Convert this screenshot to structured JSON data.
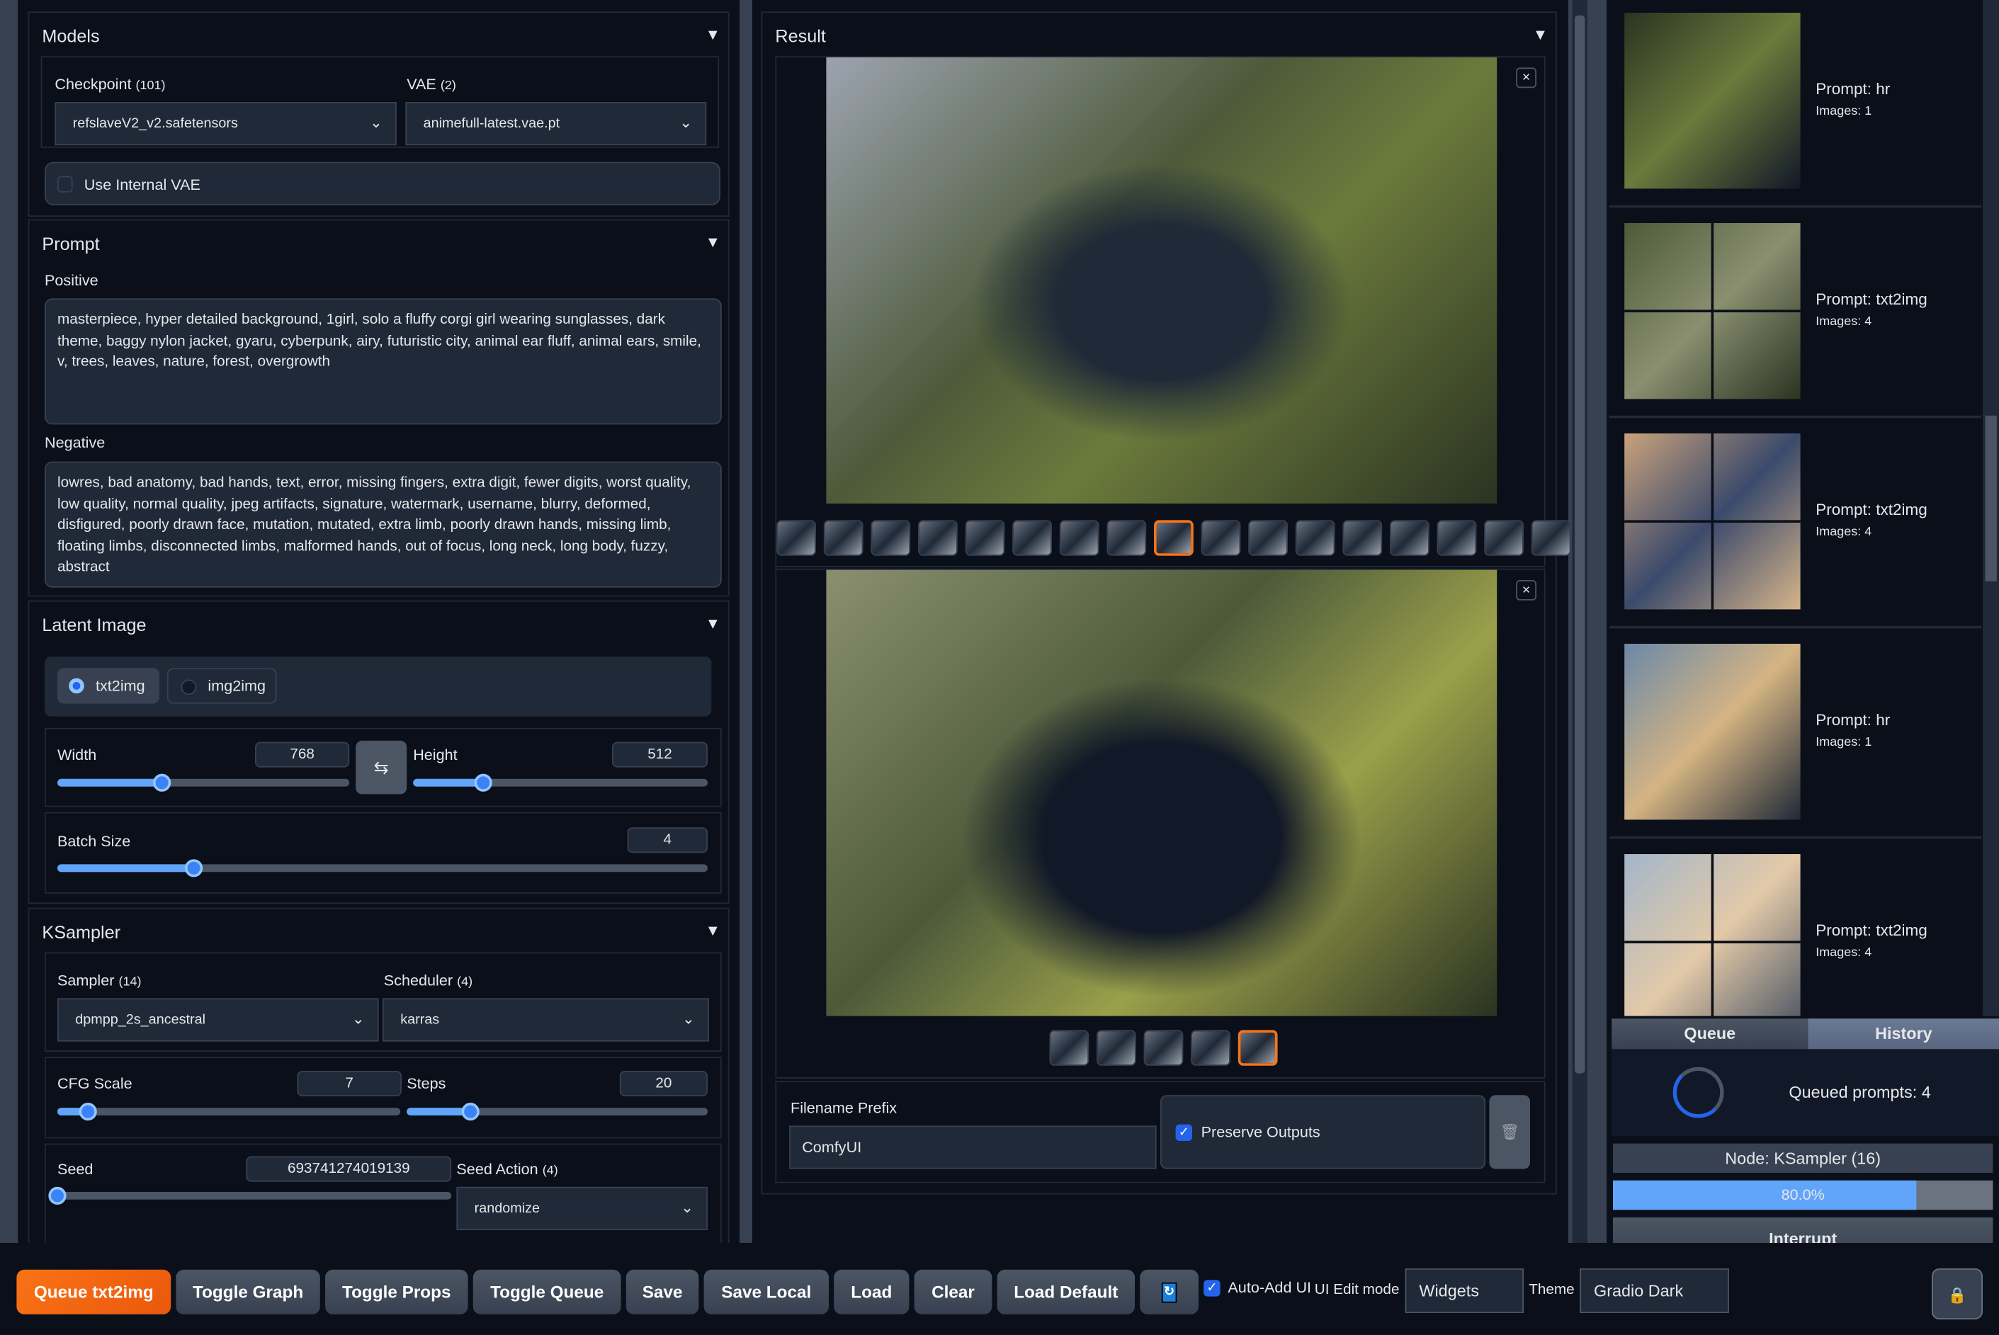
{
  "models": {
    "title": "Models",
    "checkpoint_label": "Checkpoint",
    "checkpoint_count": "(101)",
    "checkpoint_value": "refslaveV2_v2.safetensors",
    "vae_label": "VAE",
    "vae_count": "(2)",
    "vae_value": "animefull-latest.vae.pt",
    "use_internal_vae": "Use Internal VAE",
    "use_internal_vae_checked": false
  },
  "prompt": {
    "title": "Prompt",
    "positive_label": "Positive",
    "positive": "masterpiece, hyper detailed background, 1girl, solo a fluffy corgi girl wearing sunglasses, dark theme, baggy nylon jacket, gyaru, cyberpunk, airy, futuristic city, animal ear fluff, animal ears, smile, v, trees, leaves, nature, forest, overgrowth",
    "negative_label": "Negative",
    "negative": "lowres, bad anatomy, bad hands, text, error, missing fingers, extra digit, fewer digits, worst quality, low quality, normal quality, jpeg artifacts, signature, watermark, username, blurry, deformed, disfigured, poorly drawn face, mutation, mutated, extra limb, poorly drawn hands, missing limb, floating limbs, disconnected limbs, malformed hands, out of focus, long neck, long body, fuzzy, abstract"
  },
  "latent": {
    "title": "Latent Image",
    "modes": [
      "txt2img",
      "img2img"
    ],
    "selected_mode": "txt2img",
    "width_label": "Width",
    "width": "768",
    "width_level": 0.36,
    "height_label": "Height",
    "height": "512",
    "height_level": 0.24,
    "swap_icon": "swap-arrows-icon",
    "batch_label": "Batch Size",
    "batch": "4",
    "batch_level": 0.21
  },
  "ksampler": {
    "title": "KSampler",
    "sampler_label": "Sampler",
    "sampler_count": "(14)",
    "sampler_value": "dpmpp_2s_ancestral",
    "scheduler_label": "Scheduler",
    "scheduler_count": "(4)",
    "scheduler_value": "karras",
    "cfg_label": "CFG Scale",
    "cfg": "7",
    "cfg_level": 0.09,
    "steps_label": "Steps",
    "steps": "20",
    "steps_level": 0.21,
    "seed_label": "Seed",
    "seed": "693741274019139",
    "seed_level": 0.0,
    "seed_action_label": "Seed Action",
    "seed_action_count": "(4)",
    "seed_action_value": "randomize"
  },
  "result": {
    "title": "Result",
    "gallery1_selected": 8,
    "gallery1_count": 17,
    "gallery2_selected": 4,
    "gallery2_count": 5,
    "filename_prefix_label": "Filename Prefix",
    "filename_prefix": "ComfyUI",
    "preserve_outputs": "Preserve Outputs",
    "preserve_checked": true
  },
  "history": [
    {
      "prompt": "Prompt: hr",
      "images": "Images: 1"
    },
    {
      "prompt": "Prompt: txt2img",
      "images": "Images: 4"
    },
    {
      "prompt": "Prompt: txt2img",
      "images": "Images: 4"
    },
    {
      "prompt": "Prompt: hr",
      "images": "Images: 1"
    },
    {
      "prompt": "Prompt: txt2img",
      "images": "Images: 4"
    }
  ],
  "queue": {
    "tab_queue": "Queue",
    "tab_history": "History",
    "queued": "Queued prompts: 4",
    "node": "Node: KSampler (16)",
    "progress": 0.8,
    "progress_label": "80.0%",
    "interrupt": "Interrupt"
  },
  "toolbar": {
    "queue": "Queue txt2img",
    "toggle_graph": "Toggle Graph",
    "toggle_props": "Toggle Props",
    "toggle_queue": "Toggle Queue",
    "save": "Save",
    "save_local": "Save Local",
    "load": "Load",
    "clear": "Clear",
    "load_default": "Load Default",
    "auto_add": "Auto-Add UI",
    "auto_add_checked": true,
    "ui_edit_mode_label": "UI Edit mode",
    "ui_edit_mode": "Widgets",
    "theme_label": "Theme",
    "theme": "Gradio Dark"
  },
  "colors": {
    "accent": "#f97316",
    "progress": "#60a5fa",
    "background": "#0b0f19"
  }
}
